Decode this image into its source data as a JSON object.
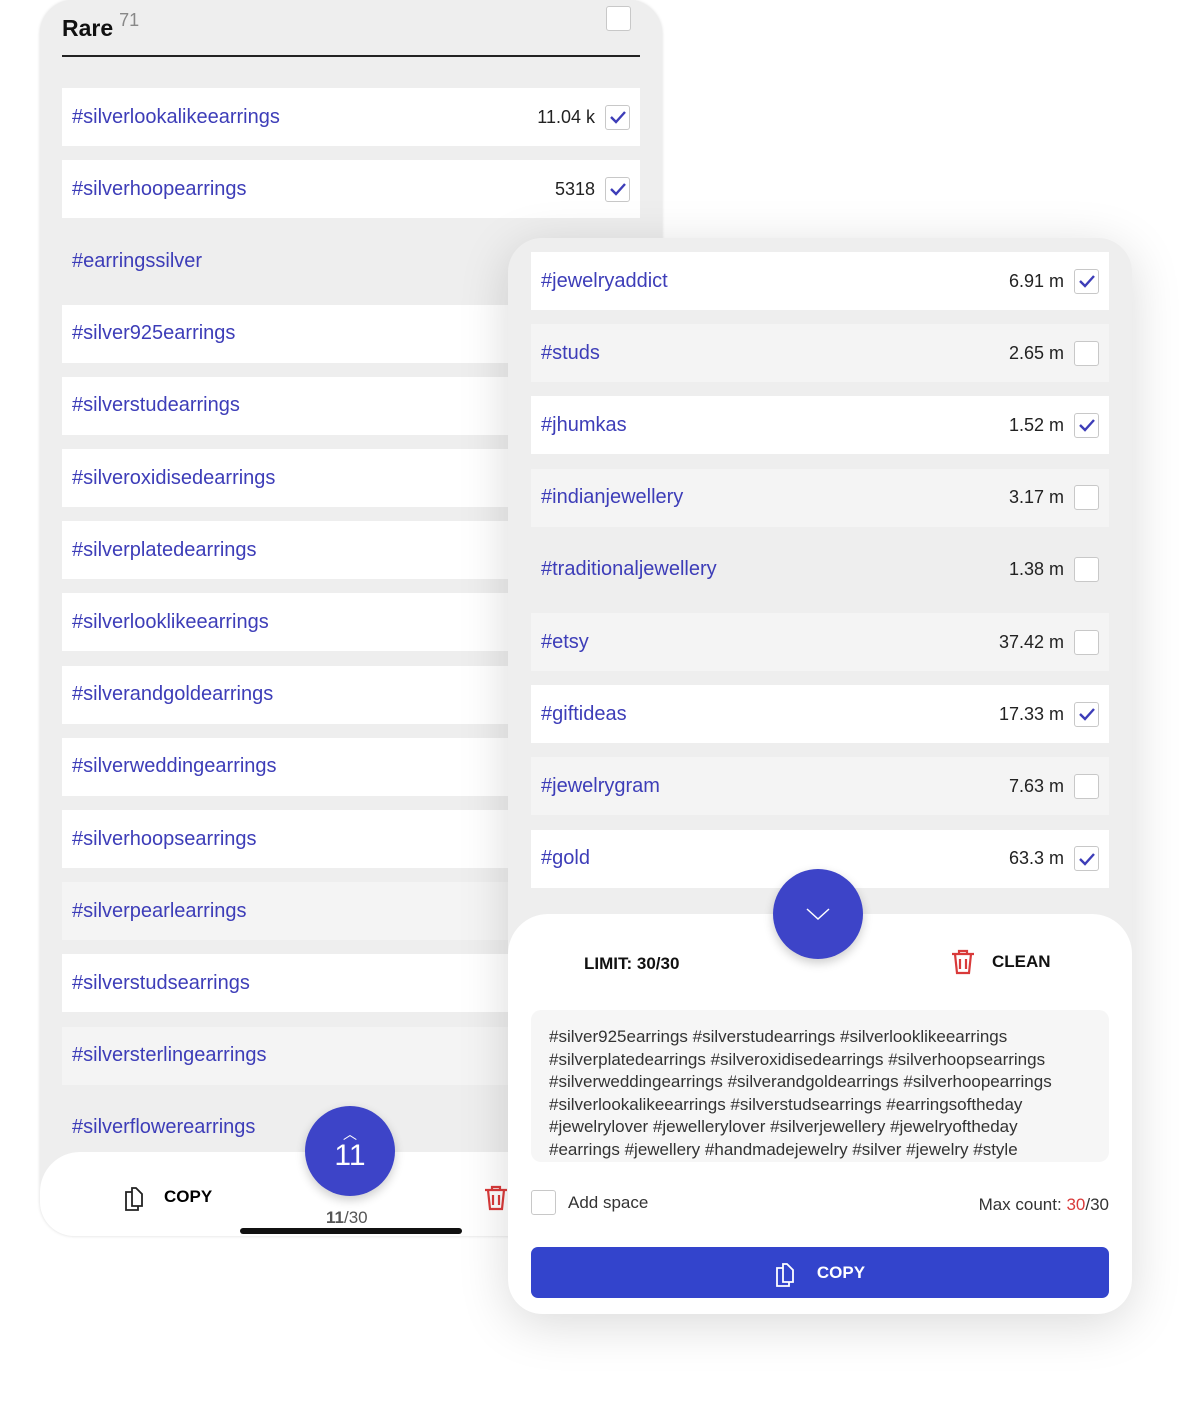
{
  "left": {
    "title": "Rare",
    "count": "71",
    "header_checked": false,
    "items": [
      {
        "tag": "#silverlookalikeearrings",
        "count": "11.04 k",
        "checked": true,
        "bg": "w"
      },
      {
        "tag": "#silverhoopearrings",
        "count": "5318",
        "checked": true,
        "bg": "w"
      },
      {
        "tag": "#earringssilver",
        "count": "",
        "checked": false,
        "bg": "n"
      },
      {
        "tag": "#silver925earrings",
        "count": "",
        "checked": true,
        "bg": "w"
      },
      {
        "tag": "#silverstudearrings",
        "count": "",
        "checked": true,
        "bg": "w"
      },
      {
        "tag": "#silveroxidisedearrings",
        "count": "",
        "checked": true,
        "bg": "w"
      },
      {
        "tag": "#silverplatedearrings",
        "count": "",
        "checked": true,
        "bg": "w"
      },
      {
        "tag": "#silverlooklikeearrings",
        "count": "",
        "checked": true,
        "bg": "w"
      },
      {
        "tag": "#silverandgoldearrings",
        "count": "",
        "checked": true,
        "bg": "w"
      },
      {
        "tag": "#silverweddingearrings",
        "count": "",
        "checked": true,
        "bg": "w"
      },
      {
        "tag": "#silverhoopsearrings",
        "count": "",
        "checked": true,
        "bg": "w"
      },
      {
        "tag": "#silverpearlearrings",
        "count": "",
        "checked": false,
        "bg": "g"
      },
      {
        "tag": "#silverstudsearrings",
        "count": "",
        "checked": true,
        "bg": "w"
      },
      {
        "tag": "#silversterlingearrings",
        "count": "",
        "checked": false,
        "bg": "g"
      },
      {
        "tag": "#silverflowerearrings",
        "count": "",
        "checked": false,
        "bg": "n"
      }
    ],
    "fab_count": "11",
    "copy_label": "COPY",
    "selected": "11",
    "limit": "/30"
  },
  "right": {
    "items": [
      {
        "tag": "#jewelryaddict",
        "count": "6.91 m",
        "checked": true,
        "bg": "w"
      },
      {
        "tag": "#studs",
        "count": "2.65 m",
        "checked": false,
        "bg": "g"
      },
      {
        "tag": "#jhumkas",
        "count": "1.52 m",
        "checked": true,
        "bg": "w"
      },
      {
        "tag": "#indianjewellery",
        "count": "3.17 m",
        "checked": false,
        "bg": "g"
      },
      {
        "tag": "#traditionaljewellery",
        "count": "1.38 m",
        "checked": false,
        "bg": "n"
      },
      {
        "tag": "#etsy",
        "count": "37.42 m",
        "checked": false,
        "bg": "g"
      },
      {
        "tag": "#giftideas",
        "count": "17.33 m",
        "checked": true,
        "bg": "w"
      },
      {
        "tag": "#jewelrygram",
        "count": "7.63 m",
        "checked": false,
        "bg": "g"
      },
      {
        "tag": "#gold",
        "count": "63.3 m",
        "checked": true,
        "bg": "w"
      }
    ],
    "sheet": {
      "limit": "LIMIT: 30/30",
      "clean": "CLEAN",
      "text": "#silver925earrings #silverstudearrings #silverlooklikeearrings #silverplatedearrings #silveroxidisedearrings #silverhoopsearrings #silverweddingearrings #silverandgoldearrings #silverhoopearrings #silverlookalikeearrings #silverstudsearrings #earringsoftheday #jewelrylover #jewellerylover #silverjewellery #jewelryoftheday #earrings #jewellery #handmadejewelry #silver #jewelry #style",
      "add_space": "Add space",
      "max_label": "Max count: ",
      "max_value": "30",
      "max_total": "/30",
      "copy": "COPY"
    }
  },
  "colors": {
    "accent": "#3d44c8",
    "button": "#3344cc",
    "danger": "#d93a3a",
    "tag": "#3d3db8"
  }
}
